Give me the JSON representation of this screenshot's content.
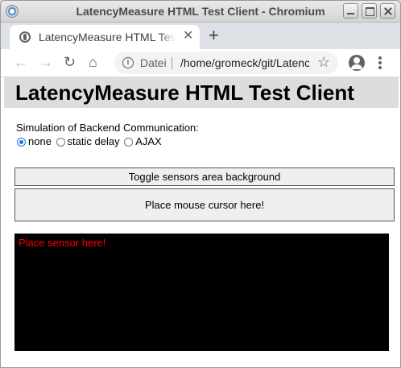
{
  "window": {
    "title": "LatencyMeasure HTML Test Client - Chromium"
  },
  "tab": {
    "title": "LatencyMeasure HTML Test Client",
    "close_glyph": "✕",
    "new_tab_glyph": "+"
  },
  "toolbar": {
    "back_glyph": "←",
    "forward_glyph": "→",
    "reload_glyph": "↻",
    "home_glyph": "⌂",
    "scheme_label": "Datei",
    "url": "/home/gromeck/git/LatencyMeasure",
    "star_glyph": "☆"
  },
  "page": {
    "heading": "LatencyMeasure HTML Test Client",
    "simulation_label": "Simulation of Backend Communication:",
    "radio_options": [
      {
        "label": "none",
        "checked": true
      },
      {
        "label": "static delay",
        "checked": false
      },
      {
        "label": "AJAX",
        "checked": false
      }
    ],
    "toggle_button_label": "Toggle sensors area background",
    "mouse_area_label": "Place mouse cursor here!",
    "sensor_label": "Place sensor here!"
  },
  "icons": {
    "app": "chromium-icon",
    "favicon": "globe-icon",
    "info": "info-icon",
    "profile": "account-icon",
    "menu": "kebab-menu-icon"
  },
  "colors": {
    "sensor_background": "#000000",
    "sensor_text": "#ff0000",
    "heading_background": "#dddddd",
    "radio_accent": "#1a73e8"
  }
}
